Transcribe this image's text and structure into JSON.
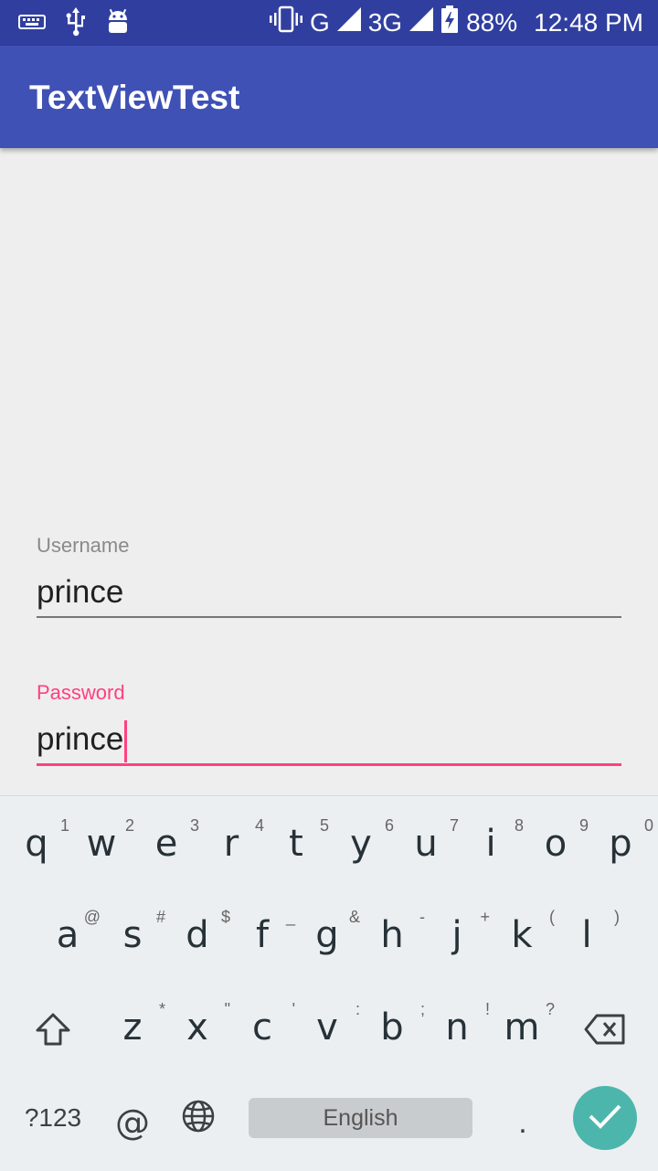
{
  "status_bar": {
    "network_g": "G",
    "network_3g": "3G",
    "battery": "88%",
    "time": "12:48 PM",
    "icons": [
      "keyboard-icon",
      "usb-icon",
      "android-icon",
      "vibrate-icon",
      "signal-icon",
      "signal-icon",
      "battery-charging-icon"
    ]
  },
  "app_bar": {
    "title": "TextViewTest",
    "color": "#3f51b5"
  },
  "form": {
    "username": {
      "label": "Username",
      "value": "prince"
    },
    "password": {
      "label": "Password",
      "value": "prince",
      "accent": "#ff4081"
    }
  },
  "keyboard": {
    "row1": [
      {
        "key": "q",
        "hint": "1"
      },
      {
        "key": "w",
        "hint": "2"
      },
      {
        "key": "e",
        "hint": "3"
      },
      {
        "key": "r",
        "hint": "4"
      },
      {
        "key": "t",
        "hint": "5"
      },
      {
        "key": "y",
        "hint": "6"
      },
      {
        "key": "u",
        "hint": "7"
      },
      {
        "key": "i",
        "hint": "8"
      },
      {
        "key": "o",
        "hint": "9"
      },
      {
        "key": "p",
        "hint": "0"
      }
    ],
    "row2": [
      {
        "key": "a",
        "hint": "@"
      },
      {
        "key": "s",
        "hint": "#"
      },
      {
        "key": "d",
        "hint": "$"
      },
      {
        "key": "f",
        "hint": "_"
      },
      {
        "key": "g",
        "hint": "&"
      },
      {
        "key": "h",
        "hint": "-"
      },
      {
        "key": "j",
        "hint": "+"
      },
      {
        "key": "k",
        "hint": "("
      },
      {
        "key": "l",
        "hint": ")"
      }
    ],
    "row3": [
      {
        "key": "z",
        "hint": "*"
      },
      {
        "key": "x",
        "hint": "\""
      },
      {
        "key": "c",
        "hint": "'"
      },
      {
        "key": "v",
        "hint": ":"
      },
      {
        "key": "b",
        "hint": ";"
      },
      {
        "key": "n",
        "hint": "!"
      },
      {
        "key": "m",
        "hint": "?"
      }
    ],
    "symbols": "?123",
    "at": "@",
    "space": "English",
    "period": ".",
    "enter_color": "#4db6ac"
  }
}
